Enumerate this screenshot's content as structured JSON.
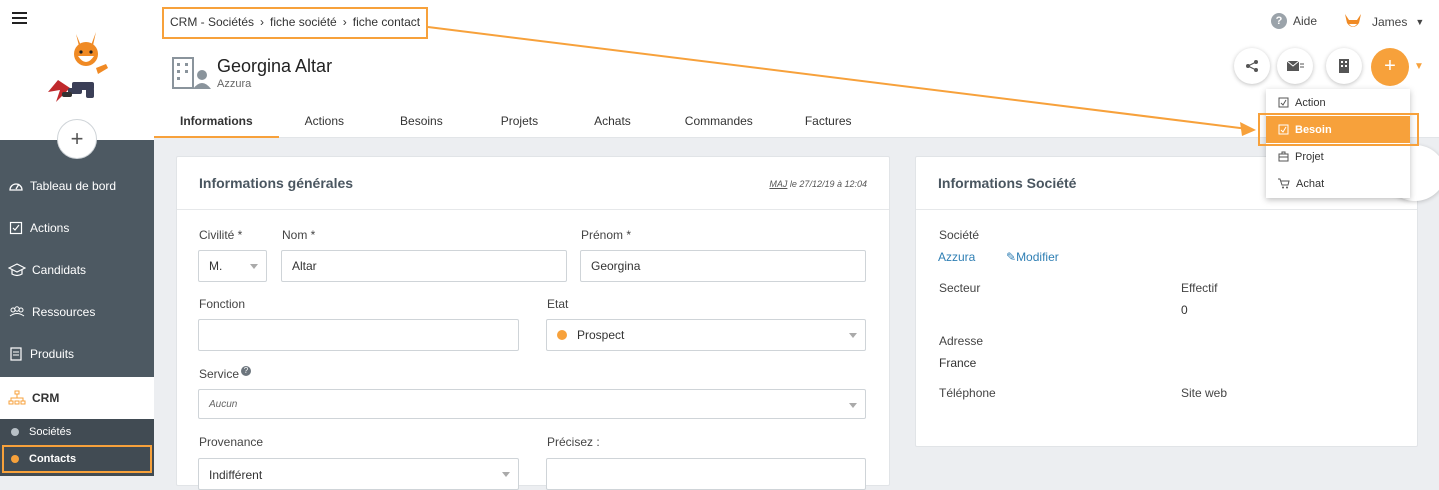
{
  "app": {
    "name": "CRM"
  },
  "breadcrumb": [
    "CRM - Sociétés",
    "fiche société",
    "fiche contact"
  ],
  "header": {
    "name": "Georgina Altar",
    "company": "Azzura",
    "help": "Aide",
    "user": "James"
  },
  "sidebar": {
    "items": [
      {
        "label": "Tableau de bord",
        "icon": "dashboard-icon"
      },
      {
        "label": "Actions",
        "icon": "checklist-icon"
      },
      {
        "label": "Candidats",
        "icon": "graduation-cap-icon"
      },
      {
        "label": "Ressources",
        "icon": "people-icon"
      },
      {
        "label": "Produits",
        "icon": "document-icon"
      },
      {
        "label": "CRM",
        "icon": "org-chart-icon",
        "active": true
      }
    ],
    "subitems": [
      {
        "label": "Sociétés"
      },
      {
        "label": "Contacts",
        "active": true
      }
    ]
  },
  "tabs": [
    "Informations",
    "Actions",
    "Besoins",
    "Projets",
    "Achats",
    "Commandes",
    "Factures"
  ],
  "dropdown": [
    {
      "label": "Action",
      "icon": "checklist-icon"
    },
    {
      "label": "Besoin",
      "icon": "checklist-icon",
      "highlighted": true
    },
    {
      "label": "Projet",
      "icon": "briefcase-icon"
    },
    {
      "label": "Achat",
      "icon": "cart-icon"
    }
  ],
  "general": {
    "title": "Informations générales",
    "maj_prefix": "MAJ",
    "maj_date": "le 27/12/19 à 12:04",
    "civilite_label": "Civilité *",
    "civilite_value": "M.",
    "nom_label": "Nom *",
    "nom_value": "Altar",
    "prenom_label": "Prénom *",
    "prenom_value": "Georgina",
    "fonction_label": "Fonction",
    "fonction_value": "",
    "etat_label": "Etat",
    "etat_value": "Prospect",
    "service_label": "Service",
    "service_placeholder": "Aucun",
    "provenance_label": "Provenance",
    "provenance_value": "Indifférent",
    "precisez_label": "Précisez :"
  },
  "company": {
    "title": "Informations Société",
    "societe_label": "Société",
    "societe_value": "Azzura",
    "modifier": "Modifier",
    "secteur_label": "Secteur",
    "effectif_label": "Effectif",
    "effectif_value": "0",
    "adresse_label": "Adresse",
    "adresse_value": "France",
    "telephone_label": "Téléphone",
    "siteweb_label": "Site web"
  },
  "colors": {
    "accent": "#f7a13b",
    "sidebar": "#4d5962",
    "link": "#2f7fb4"
  }
}
